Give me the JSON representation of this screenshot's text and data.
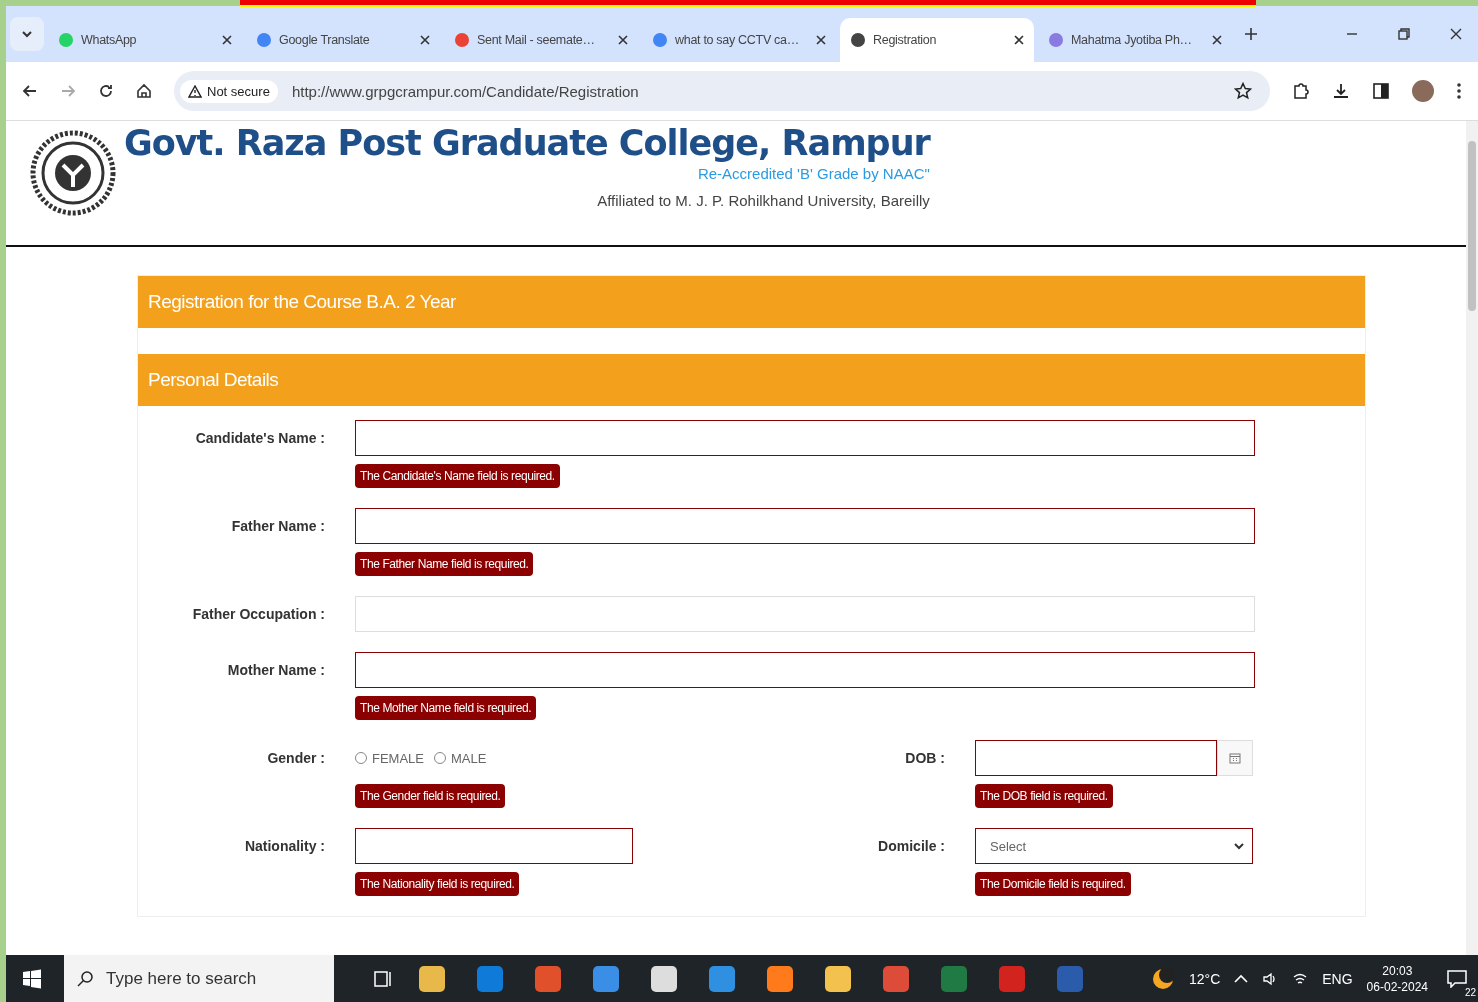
{
  "browser": {
    "tabs": [
      {
        "title": "WhatsApp",
        "selected": false
      },
      {
        "title": "Google Translate",
        "selected": false
      },
      {
        "title": "Sent Mail - seemate…",
        "selected": false
      },
      {
        "title": "what to say CCTV ca…",
        "selected": false
      },
      {
        "title": "Registration",
        "selected": true
      },
      {
        "title": "Mahatma Jyotiba Ph…",
        "selected": false
      }
    ],
    "security": "Not secure",
    "url": "http://www.grpgcrampur.com/Candidate/Registration"
  },
  "header": {
    "title": "Govt. Raza Post Graduate College, Rampur",
    "accreditation": "Re-Accredited 'B' Grade by NAAC\"",
    "affiliation": "Affiliated to M. J. P. Rohilkhand University, Bareilly"
  },
  "form": {
    "title": "Registration for the Course B.A. 2 Year",
    "section": "Personal Details",
    "rows": [
      [
        {
          "kind": "text",
          "label": "Candidate's Name :",
          "invalid": true,
          "error": "The Candidate's Name field is required."
        }
      ],
      [
        {
          "kind": "text",
          "label": "Father Name :",
          "invalid": true,
          "error": "The Father Name field is required."
        }
      ],
      [
        {
          "kind": "text",
          "label": "Father Occupation :",
          "invalid": false
        }
      ],
      [
        {
          "kind": "text",
          "label": "Mother Name :",
          "invalid": true,
          "error": "The Mother Name field is required."
        }
      ],
      [
        {
          "kind": "radio",
          "label": "Gender :",
          "options": [
            {
              "label": "FEMALE",
              "selected": false
            },
            {
              "label": "MALE",
              "selected": false
            }
          ],
          "error": "The Gender field is required."
        },
        {
          "kind": "date",
          "label": "DOB :",
          "invalid": true,
          "error": "The DOB field is required."
        }
      ],
      [
        {
          "kind": "text",
          "label": "Nationality :",
          "invalid": true,
          "error": "The Nationality field is required."
        },
        {
          "kind": "select",
          "label": "Domicile :",
          "invalid": true,
          "placeholder": "Select",
          "error": "The Domicile field is required."
        }
      ]
    ]
  },
  "taskbar": {
    "search": {
      "placeholder": "Type here to search"
    },
    "temperature": "12°C",
    "language": "ENG",
    "time": "20:03",
    "date": "06-02-2024",
    "notifications": "22"
  }
}
